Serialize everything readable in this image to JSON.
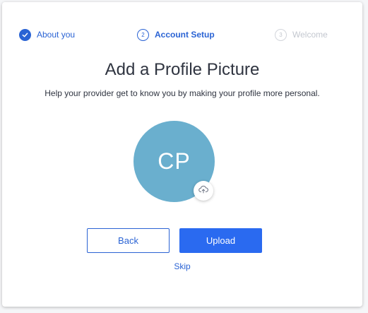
{
  "stepper": {
    "steps": [
      {
        "label": "About you",
        "number": "1",
        "state": "completed"
      },
      {
        "label": "Account Setup",
        "number": "2",
        "state": "active"
      },
      {
        "label": "Welcome",
        "number": "3",
        "state": "upcoming"
      }
    ]
  },
  "main": {
    "title": "Add a Profile Picture",
    "subtitle": "Help your provider get to know you by making your profile more personal.",
    "avatar_initials": "CP",
    "avatar_color": "#6aafce",
    "upload_icon": "cloud-upload-icon"
  },
  "actions": {
    "back_label": "Back",
    "upload_label": "Upload",
    "skip_label": "Skip"
  },
  "colors": {
    "accent": "#2a63d4",
    "primary_button": "#2a6af0",
    "inactive": "#c3c7cf"
  }
}
